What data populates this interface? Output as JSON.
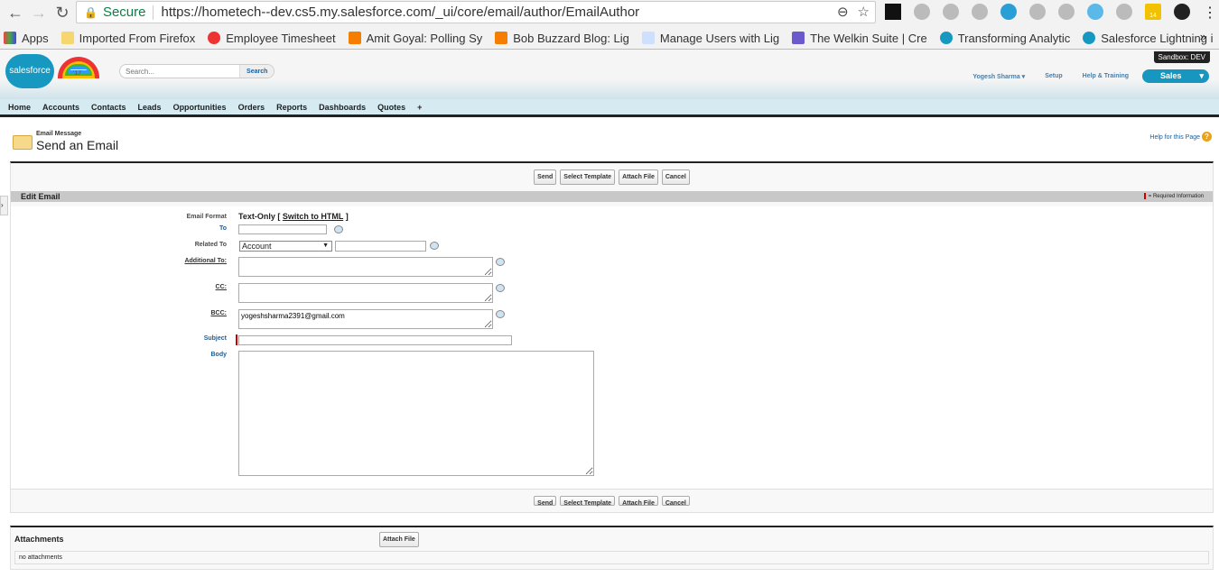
{
  "browser": {
    "secure_label": "Secure",
    "url": "https://hometech--dev.cs5.my.salesforce.com/_ui/core/email/author/EmailAuthor",
    "ext_badge": "14",
    "bookmarks": [
      "Apps",
      "Imported From Firefox",
      "Employee Timesheet",
      "Amit Goyal: Polling Sy",
      "Bob Buzzard Blog: Lig",
      "Manage Users with Lig",
      "The Welkin Suite | Cre",
      "Transforming Analytic",
      "Salesforce Lightning i"
    ],
    "more": "»"
  },
  "header": {
    "logo": "salesforce",
    "anniv": "'17",
    "search_placeholder": "Search...",
    "search_button": "Search",
    "sandbox": "Sandbox:  DEV",
    "user": "Yogesh Sharma",
    "setup": "Setup",
    "help": "Help & Training",
    "app": "Sales"
  },
  "tabs": [
    "Home",
    "Accounts",
    "Contacts",
    "Leads",
    "Opportunities",
    "Orders",
    "Reports",
    "Dashboards",
    "Quotes",
    "+"
  ],
  "page": {
    "type": "Email Message",
    "title": "Send an Email",
    "help": "Help for this Page"
  },
  "buttons": {
    "send": "Send",
    "template": "Select Template",
    "attach": "Attach File",
    "cancel": "Cancel"
  },
  "section": {
    "title": "Edit Email",
    "required": "= Required Information"
  },
  "form": {
    "format_label": "Email Format",
    "format_value": "Text-Only",
    "switch": "Switch to HTML",
    "to_label": "To",
    "related_label": "Related To",
    "related_value": "Account",
    "additional_label": "Additional To:",
    "cc_label": "CC:",
    "bcc_label": "BCC:",
    "bcc_value": "yogeshsharma2391@gmail.com",
    "subject_label": "Subject",
    "body_label": "Body"
  },
  "attachments": {
    "title": "Attachments",
    "button": "Attach File",
    "empty": "no attachments"
  }
}
